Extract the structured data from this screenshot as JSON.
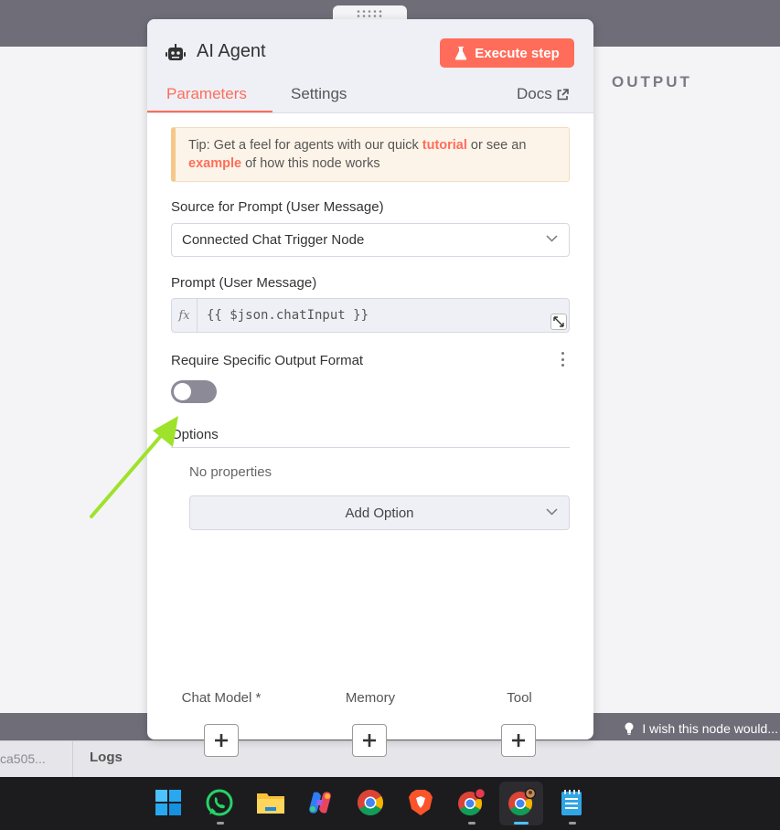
{
  "output": {
    "label": "OUTPUT"
  },
  "panel": {
    "title": "AI Agent",
    "execute_label": "Execute step",
    "tabs": [
      {
        "label": "Parameters",
        "active": true
      },
      {
        "label": "Settings",
        "active": false
      }
    ],
    "docs_label": "Docs",
    "tip": {
      "prefix": "Tip: Get a feel for agents with our quick ",
      "link1": "tutorial",
      "middle": " or see an ",
      "link2": "example",
      "suffix": " of how this node works"
    },
    "source_prompt": {
      "label": "Source for Prompt (User Message)",
      "value": "Connected Chat Trigger Node"
    },
    "prompt": {
      "label": "Prompt (User Message)",
      "fx": "fx",
      "value": "{{ $json.chatInput }}"
    },
    "output_format": {
      "label": "Require Specific Output Format",
      "enabled": false
    },
    "options": {
      "label": "Options",
      "empty_text": "No properties",
      "add_label": "Add Option"
    },
    "sub_nodes": [
      {
        "label": "Chat Model *"
      },
      {
        "label": "Memory"
      },
      {
        "label": "Tool"
      }
    ]
  },
  "feedback": {
    "text": "I wish this node would..."
  },
  "bottom": {
    "hash_tab": "ca505...",
    "logs_tab": "Logs"
  },
  "taskbar": {
    "icons": [
      "windows-start-icon",
      "whatsapp-icon",
      "file-explorer-icon",
      "copilot-icon",
      "chrome-icon",
      "brave-icon",
      "chrome-profile-icon",
      "chrome-active-icon",
      "notepad-icon"
    ]
  },
  "colors": {
    "accent": "#ff6d5a",
    "arrow": "#9ee22b"
  }
}
